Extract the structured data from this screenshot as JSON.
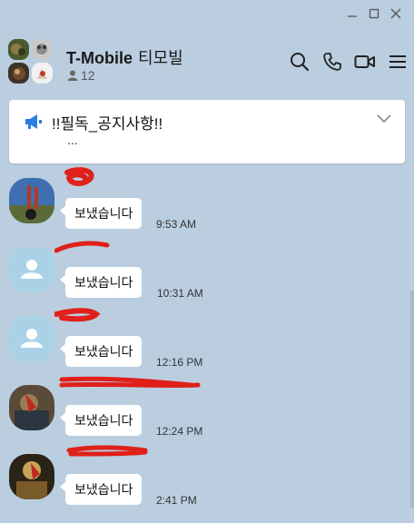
{
  "window": {
    "controls": [
      "minimize",
      "maximize",
      "close"
    ]
  },
  "header": {
    "title": "T-Mobile",
    "subtitle": "티모빌",
    "member_count": "12",
    "icons": [
      "search-icon",
      "phone-icon",
      "video-icon",
      "menu-icon"
    ]
  },
  "notice": {
    "title": "!!필독_공지사항!!",
    "preview": "...",
    "accent": "#2a7ee0"
  },
  "messages": [
    {
      "sender": "",
      "text": "보냈습니다",
      "time": "9:53 AM",
      "avatar": "photo-avatar"
    },
    {
      "sender": "",
      "text": "보냈습니다",
      "time": "10:31 AM",
      "avatar": "default-avatar"
    },
    {
      "sender": "",
      "text": "보냈습니다",
      "time": "12:16 PM",
      "avatar": "default-avatar"
    },
    {
      "sender": "",
      "text": "보냈습니다",
      "time": "12:24 PM",
      "avatar": "photo-avatar"
    },
    {
      "sender": "",
      "text": "보냈습니다",
      "time": "2:41 PM",
      "avatar": "photo-avatar"
    }
  ],
  "colors": {
    "background": "#bacee0",
    "bubble": "#ffffff",
    "redaction": "#e0201a"
  }
}
